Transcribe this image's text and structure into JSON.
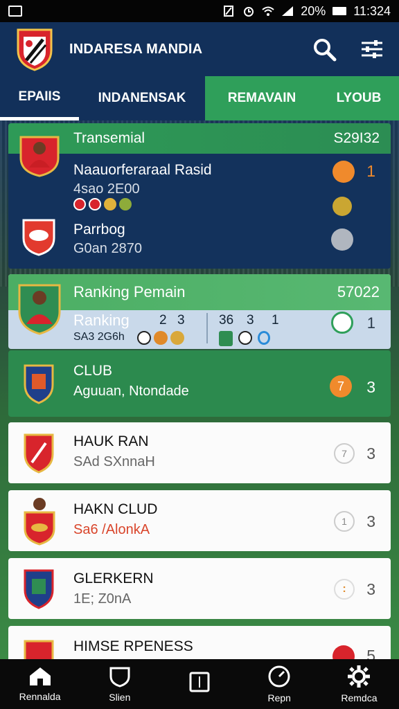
{
  "status_bar": {
    "battery": "20%",
    "time": "11:324"
  },
  "app": {
    "title": "INDARESA MANDIA"
  },
  "tabs": [
    {
      "label": "EPAIIS"
    },
    {
      "label": "INDANENSAK"
    },
    {
      "label": "REMAVAIN"
    },
    {
      "label": "LYOUB"
    }
  ],
  "card_transfer": {
    "title": "Transemial",
    "value": "S29I32",
    "rows": [
      {
        "name": "Naauorferaraal Rasid",
        "sub": "4sao 2E00",
        "count": "1"
      },
      {
        "name": "Parrbog",
        "sub": "G0an 2870",
        "count": ""
      }
    ]
  },
  "card_ranking": {
    "title": "Ranking Pemain",
    "value": "57022",
    "row_label": "Ranking",
    "row_sub": "SA3 2G6h",
    "n1": "2",
    "n2": "3",
    "n3": "36",
    "n4": "3",
    "n5": "1",
    "count": "1"
  },
  "club": {
    "name": "CLUB",
    "sub": "Aguuan, Ntondade",
    "count": "3",
    "badge": "7"
  },
  "list": [
    {
      "name": "HAUK RAN",
      "sub": "SAd SXnnaH",
      "count": "3",
      "badge": "7",
      "sub_color": "#666666"
    },
    {
      "name": "HAKN CLUD",
      "sub": "Sa6 /AlonkA",
      "count": "3",
      "badge": "1",
      "sub_color": "#d9452b"
    },
    {
      "name": "GLERKERN",
      "sub": "1E; Z0nA",
      "count": "3",
      "badge": ":",
      "sub_color": "#666666"
    },
    {
      "name": "HIMSE RPENESS",
      "sub": "",
      "count": "5",
      "badge": "",
      "sub_color": "#666666"
    }
  ],
  "bottom_nav": [
    {
      "label": "Rennalda",
      "icon": "home-icon"
    },
    {
      "label": "Slien",
      "icon": "shield-icon"
    },
    {
      "label": "",
      "icon": "square-icon"
    },
    {
      "label": "Repn",
      "icon": "gauge-icon"
    },
    {
      "label": "Remdca",
      "icon": "gear-icon"
    }
  ],
  "colors": {
    "navy": "#12305a",
    "green": "#2f9f5a",
    "accent_orange": "#f08a2c"
  }
}
